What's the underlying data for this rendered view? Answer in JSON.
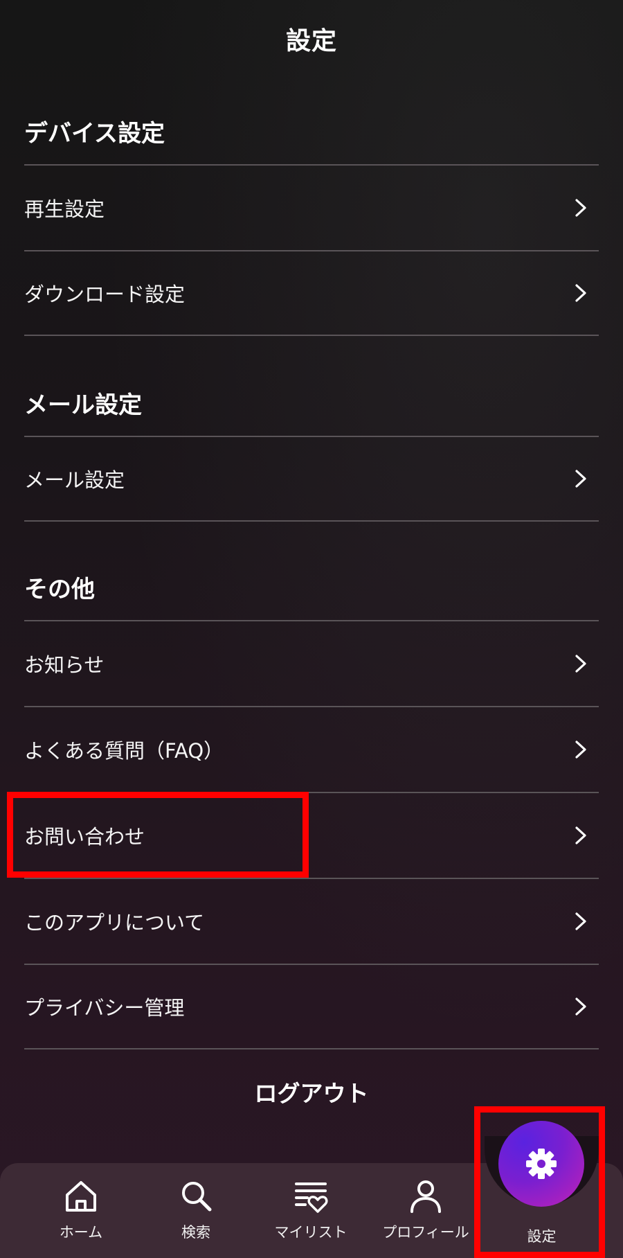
{
  "header": {
    "title": "設定"
  },
  "sections": [
    {
      "title": "デバイス設定",
      "items": [
        {
          "label": "再生設定"
        },
        {
          "label": "ダウンロード設定"
        }
      ]
    },
    {
      "title": "メール設定",
      "items": [
        {
          "label": "メール設定"
        }
      ]
    },
    {
      "title": "その他",
      "items": [
        {
          "label": "お知らせ"
        },
        {
          "label": "よくある質問（FAQ）"
        },
        {
          "label": "お問い合わせ"
        },
        {
          "label": "このアプリについて"
        },
        {
          "label": "プライバシー管理"
        }
      ]
    }
  ],
  "logout_label": "ログアウト",
  "tabbar": {
    "items": [
      {
        "label": "ホーム",
        "icon": "home-icon"
      },
      {
        "label": "検索",
        "icon": "search-icon"
      },
      {
        "label": "マイリスト",
        "icon": "mylist-heart-icon"
      },
      {
        "label": "プロフィール",
        "icon": "profile-icon"
      },
      {
        "label": "設定",
        "icon": "gear-icon",
        "active": true
      }
    ]
  },
  "colors": {
    "highlight": "#ff0000",
    "fab_gradient_start": "#5a22e0",
    "fab_gradient_end": "#c222b6",
    "tabbar_bg": "#3d2a35",
    "divider": "#5a5458"
  }
}
